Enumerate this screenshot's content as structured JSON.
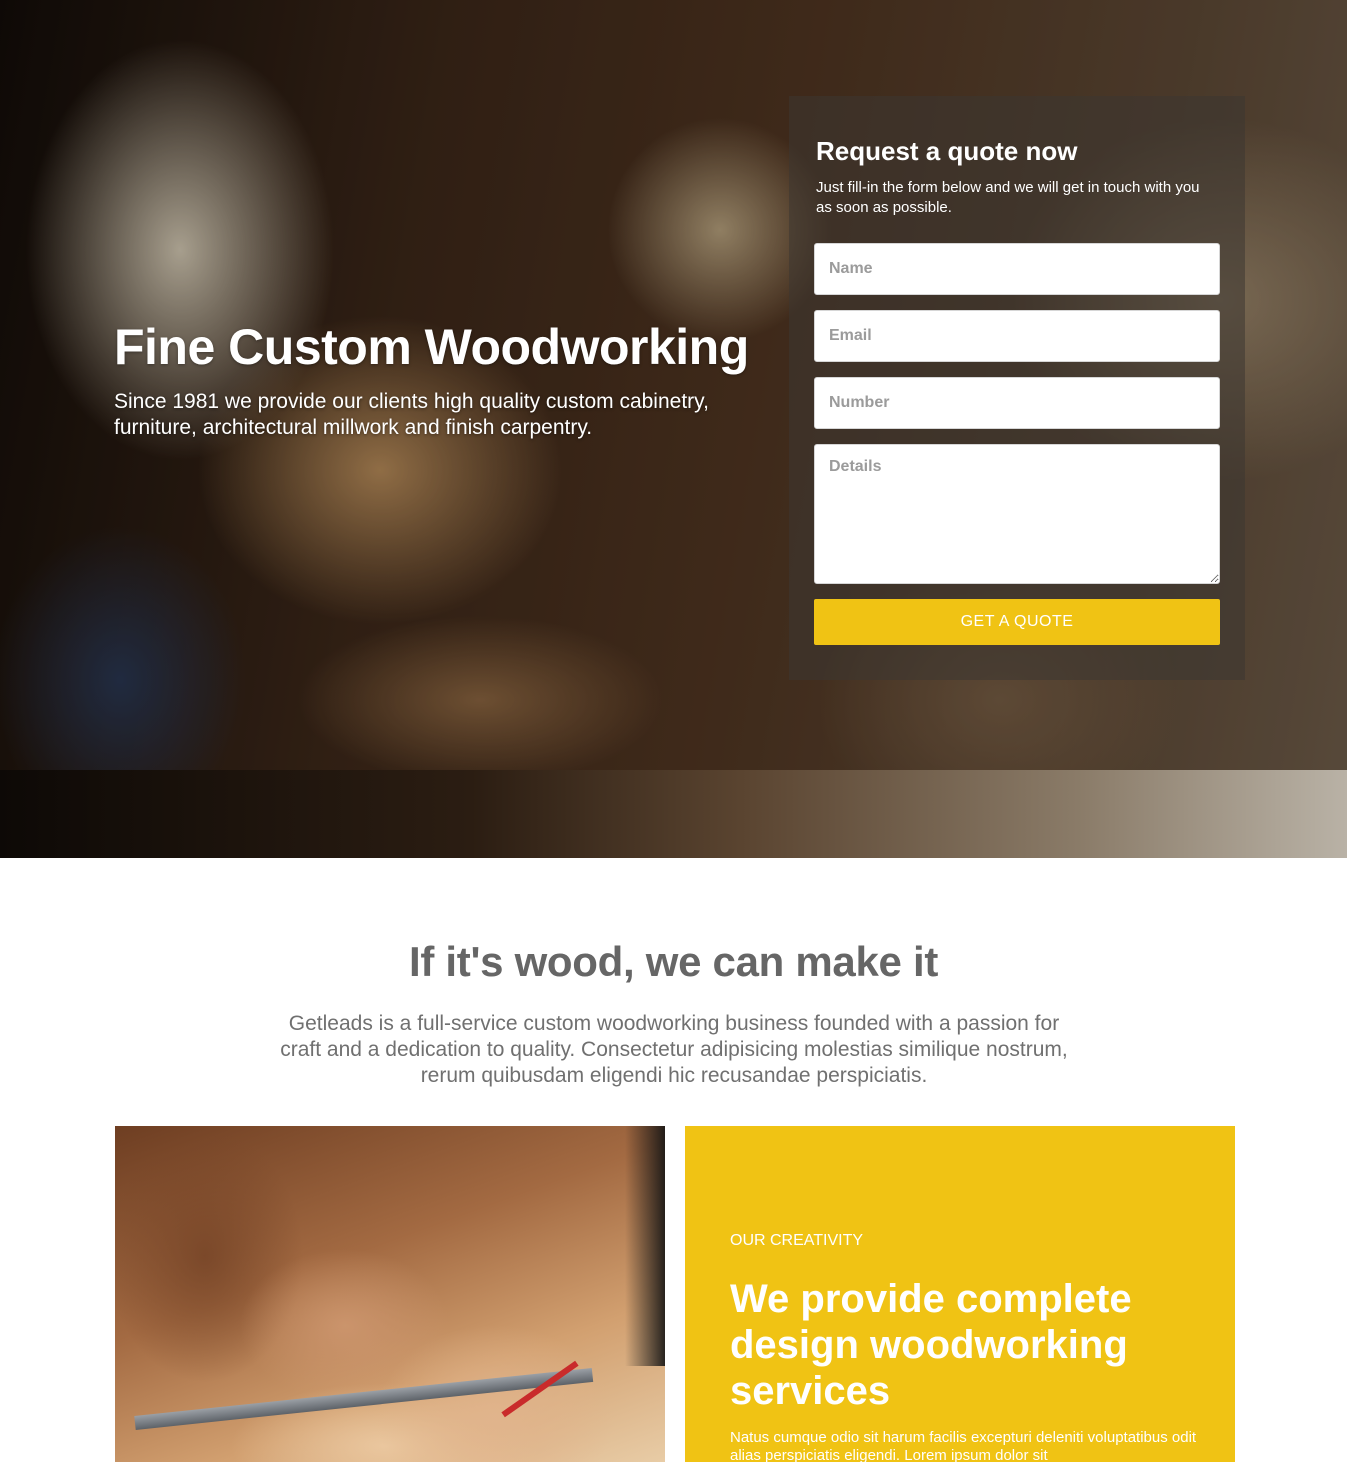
{
  "hero": {
    "title": "Fine Custom Woodworking",
    "subtitle": "Since 1981 we provide our clients high quality custom cabinetry, furniture, architectural millwork and finish carpentry."
  },
  "quote_form": {
    "title": "Request a quote now",
    "description": "Just fill-in the form below and we will get in touch with you as soon as possible.",
    "name_placeholder": "Name",
    "email_placeholder": "Email",
    "number_placeholder": "Number",
    "details_placeholder": "Details",
    "submit_label": "GET A QUOTE"
  },
  "about": {
    "heading": "If it's wood, we can make it",
    "text": "Getleads is a full-service custom woodworking business founded with a passion for craft and a dedication to quality. Consectetur adipisicing molestias similique nostrum, rerum quibusdam eligendi hic recusandae perspiciatis."
  },
  "feature": {
    "kicker": "OUR CREATIVITY",
    "title": "We provide complete design woodworking services",
    "body": "Natus cumque odio sit harum facilis excepturi deleniti voluptatibus odit alias perspiciatis eligendi. Lorem ipsum dolor sit"
  },
  "colors": {
    "accent": "#f0c314",
    "heading_gray": "#666666",
    "text_gray": "#707070"
  }
}
